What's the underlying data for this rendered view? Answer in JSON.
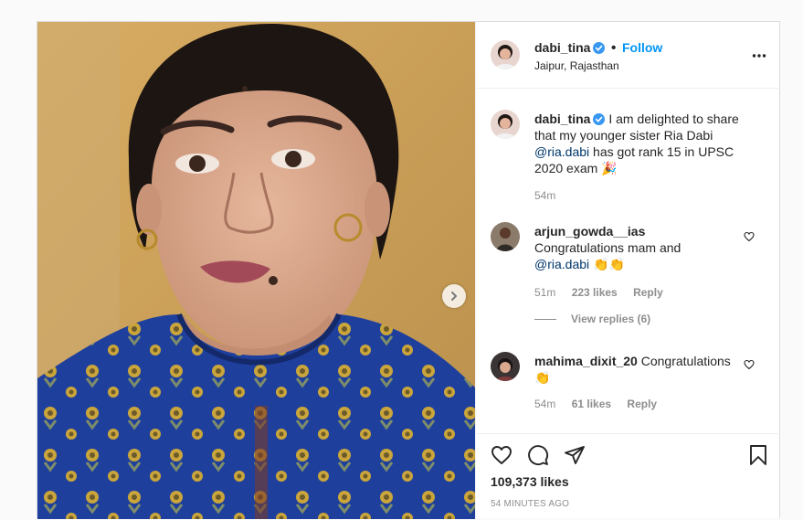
{
  "post": {
    "username": "dabi_tina",
    "follow_label": "Follow",
    "location": "Jaipur, Rajasthan"
  },
  "caption": {
    "username": "dabi_tina",
    "text_part1": "I am delighted to share that my younger sister Ria Dabi ",
    "mention": "@ria.dabi",
    "text_part2": " has got rank 15 in UPSC 2020 exam",
    "emoji": "🎉",
    "time": "54m"
  },
  "comments": [
    {
      "username": "arjun_gowda__ias",
      "text": "Congratulations mam and",
      "mention": "@ria.dabi",
      "emoji": "👏👏",
      "time": "51m",
      "likes": "223 likes",
      "reply_label": "Reply",
      "view_replies": "View replies (6)"
    },
    {
      "username": "mahima_dixit_20",
      "text": "Congratulations",
      "emoji": "👏",
      "time": "54m",
      "likes": "61 likes",
      "reply_label": "Reply"
    }
  ],
  "actions": {
    "likes": "109,373 likes",
    "posted": "54 MINUTES AGO"
  },
  "icons": {
    "more": "more-options-icon",
    "verified": "verified-badge-icon",
    "heart": "heart-icon",
    "comment": "comment-icon",
    "share": "share-icon",
    "save": "bookmark-icon",
    "next": "chevron-right-icon"
  },
  "colors": {
    "link": "#0095f6",
    "mention": "#00376b",
    "verified": "#3897f0",
    "muted": "#8e8e8e",
    "border": "#dbdbdb"
  }
}
